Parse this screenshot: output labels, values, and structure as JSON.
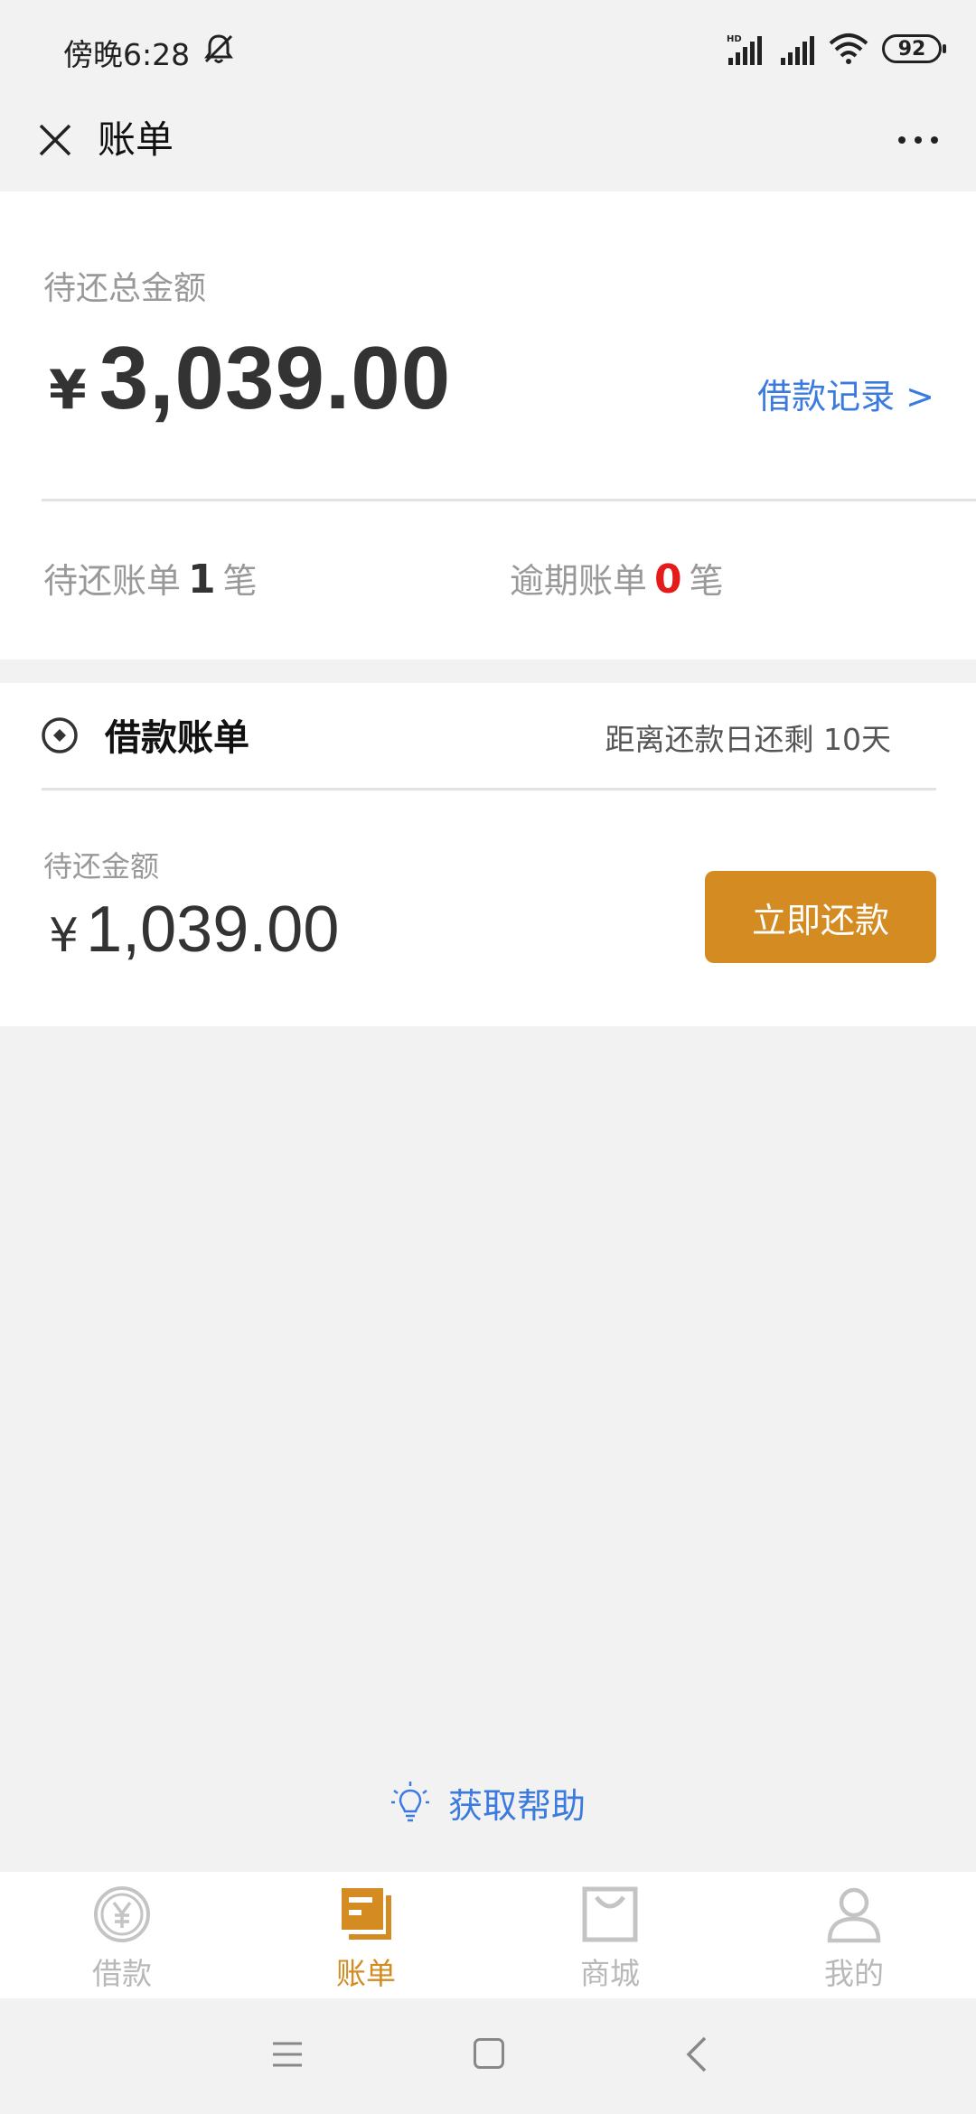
{
  "status_bar": {
    "time": "傍晚6:28",
    "battery": "92"
  },
  "header": {
    "title": "账单"
  },
  "summary": {
    "label": "待还总金额",
    "currency": "¥",
    "amount": "3,039.00",
    "loan_record_link": "借款记录 >",
    "pending_prefix": "待还账单",
    "pending_count": "1",
    "pending_suffix": "笔",
    "overdue_prefix": "逾期账单",
    "overdue_count": "0",
    "overdue_suffix": "笔"
  },
  "bill": {
    "title": "借款账单",
    "due_text": "距离还款日还剩 10天",
    "label": "待还金额",
    "currency": "¥",
    "amount": "1,039.00",
    "pay_button": "立即还款"
  },
  "help": {
    "label": "获取帮助"
  },
  "tabbar": {
    "tabs": [
      {
        "label": "借款",
        "icon": "yen-coin-icon",
        "active": false
      },
      {
        "label": "账单",
        "icon": "bill-icon",
        "active": true
      },
      {
        "label": "商城",
        "icon": "shopping-bag-icon",
        "active": false
      },
      {
        "label": "我的",
        "icon": "person-icon",
        "active": false
      }
    ]
  },
  "colors": {
    "accent": "#d38b22",
    "link": "#3b7be0",
    "overdue": "#e41b1b",
    "background": "#f2f2f2"
  }
}
